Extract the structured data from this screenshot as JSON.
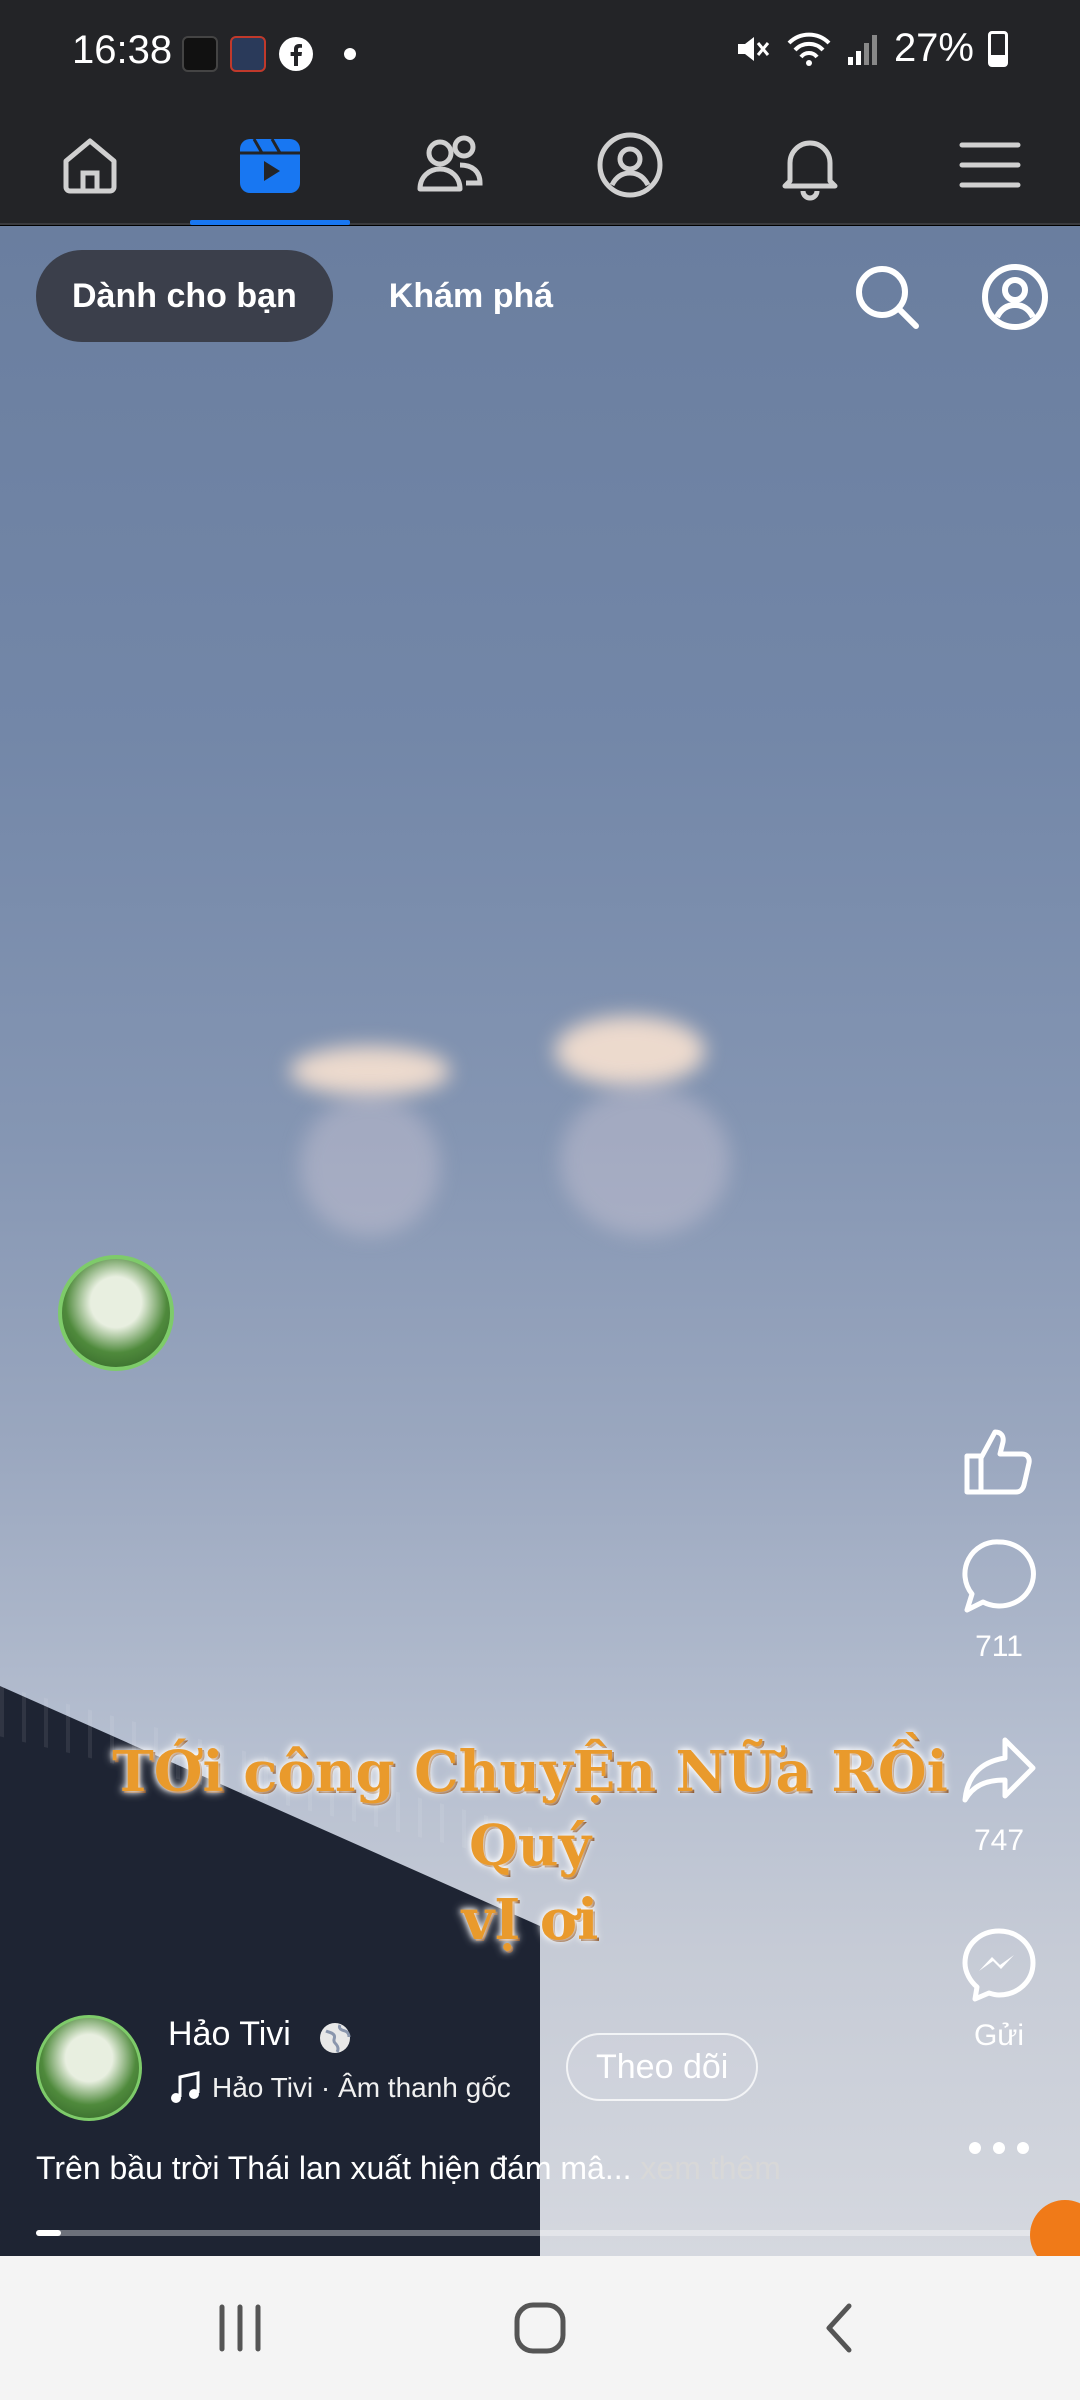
{
  "status_bar": {
    "time": "16:38",
    "battery": "27%"
  },
  "nav": {
    "items": [
      "home-icon",
      "video-icon",
      "friends-icon",
      "profile-icon",
      "notifications-icon",
      "menu-icon"
    ],
    "active": "video-icon",
    "accent": "#1877f2"
  },
  "feed_tabs": {
    "for_you": "Dành cho bạn",
    "explore": "Khám phá"
  },
  "overlay_caption": {
    "line1": "TỚi công ChuyỆn NỮa RỒi Quý",
    "line2": "vỊ ơi"
  },
  "actions": {
    "comments": "711",
    "shares": "747",
    "send_label": "Gửi"
  },
  "post": {
    "author": "Hảo Tivi",
    "audio": "Hảo Tivi · Âm thanh gốc",
    "follow_label": "Theo dõi",
    "description": "Trên bầu trời Thái lan xuất hiện đám mâ...",
    "see_more": "xem thêm",
    "progress": 0.02
  }
}
